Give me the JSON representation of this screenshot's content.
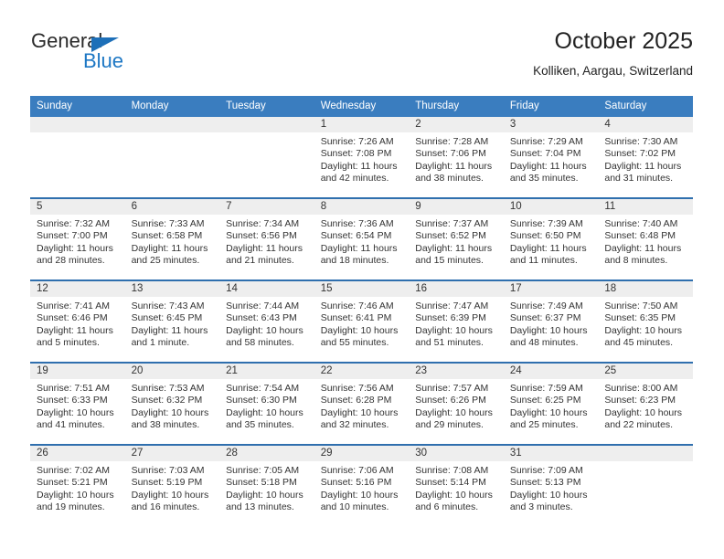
{
  "brand": {
    "line1": "General",
    "line2": "Blue",
    "triangle_color": "#1d6fb8",
    "line2_color": "#1d77c4"
  },
  "header": {
    "title": "October 2025",
    "subtitle": "Kolliken, Aargau, Switzerland"
  },
  "theme": {
    "header_blue": "#3a7dbf",
    "row_border_blue": "#2f6fae",
    "daynum_gray": "#eeeeee"
  },
  "labels": {
    "sunrise": "Sunrise:",
    "sunset": "Sunset:",
    "daylight": "Daylight:"
  },
  "weekdays": [
    "Sunday",
    "Monday",
    "Tuesday",
    "Wednesday",
    "Thursday",
    "Friday",
    "Saturday"
  ],
  "weeks": [
    [
      {
        "day": "",
        "blank": true
      },
      {
        "day": "",
        "blank": true
      },
      {
        "day": "",
        "blank": true
      },
      {
        "day": "1",
        "sunrise": "Sunrise: 7:26 AM",
        "sunset": "Sunset: 7:08 PM",
        "daylight": "Daylight: 11 hours and 42 minutes."
      },
      {
        "day": "2",
        "sunrise": "Sunrise: 7:28 AM",
        "sunset": "Sunset: 7:06 PM",
        "daylight": "Daylight: 11 hours and 38 minutes."
      },
      {
        "day": "3",
        "sunrise": "Sunrise: 7:29 AM",
        "sunset": "Sunset: 7:04 PM",
        "daylight": "Daylight: 11 hours and 35 minutes."
      },
      {
        "day": "4",
        "sunrise": "Sunrise: 7:30 AM",
        "sunset": "Sunset: 7:02 PM",
        "daylight": "Daylight: 11 hours and 31 minutes."
      }
    ],
    [
      {
        "day": "5",
        "sunrise": "Sunrise: 7:32 AM",
        "sunset": "Sunset: 7:00 PM",
        "daylight": "Daylight: 11 hours and 28 minutes."
      },
      {
        "day": "6",
        "sunrise": "Sunrise: 7:33 AM",
        "sunset": "Sunset: 6:58 PM",
        "daylight": "Daylight: 11 hours and 25 minutes."
      },
      {
        "day": "7",
        "sunrise": "Sunrise: 7:34 AM",
        "sunset": "Sunset: 6:56 PM",
        "daylight": "Daylight: 11 hours and 21 minutes."
      },
      {
        "day": "8",
        "sunrise": "Sunrise: 7:36 AM",
        "sunset": "Sunset: 6:54 PM",
        "daylight": "Daylight: 11 hours and 18 minutes."
      },
      {
        "day": "9",
        "sunrise": "Sunrise: 7:37 AM",
        "sunset": "Sunset: 6:52 PM",
        "daylight": "Daylight: 11 hours and 15 minutes."
      },
      {
        "day": "10",
        "sunrise": "Sunrise: 7:39 AM",
        "sunset": "Sunset: 6:50 PM",
        "daylight": "Daylight: 11 hours and 11 minutes."
      },
      {
        "day": "11",
        "sunrise": "Sunrise: 7:40 AM",
        "sunset": "Sunset: 6:48 PM",
        "daylight": "Daylight: 11 hours and 8 minutes."
      }
    ],
    [
      {
        "day": "12",
        "sunrise": "Sunrise: 7:41 AM",
        "sunset": "Sunset: 6:46 PM",
        "daylight": "Daylight: 11 hours and 5 minutes."
      },
      {
        "day": "13",
        "sunrise": "Sunrise: 7:43 AM",
        "sunset": "Sunset: 6:45 PM",
        "daylight": "Daylight: 11 hours and 1 minute."
      },
      {
        "day": "14",
        "sunrise": "Sunrise: 7:44 AM",
        "sunset": "Sunset: 6:43 PM",
        "daylight": "Daylight: 10 hours and 58 minutes."
      },
      {
        "day": "15",
        "sunrise": "Sunrise: 7:46 AM",
        "sunset": "Sunset: 6:41 PM",
        "daylight": "Daylight: 10 hours and 55 minutes."
      },
      {
        "day": "16",
        "sunrise": "Sunrise: 7:47 AM",
        "sunset": "Sunset: 6:39 PM",
        "daylight": "Daylight: 10 hours and 51 minutes."
      },
      {
        "day": "17",
        "sunrise": "Sunrise: 7:49 AM",
        "sunset": "Sunset: 6:37 PM",
        "daylight": "Daylight: 10 hours and 48 minutes."
      },
      {
        "day": "18",
        "sunrise": "Sunrise: 7:50 AM",
        "sunset": "Sunset: 6:35 PM",
        "daylight": "Daylight: 10 hours and 45 minutes."
      }
    ],
    [
      {
        "day": "19",
        "sunrise": "Sunrise: 7:51 AM",
        "sunset": "Sunset: 6:33 PM",
        "daylight": "Daylight: 10 hours and 41 minutes."
      },
      {
        "day": "20",
        "sunrise": "Sunrise: 7:53 AM",
        "sunset": "Sunset: 6:32 PM",
        "daylight": "Daylight: 10 hours and 38 minutes."
      },
      {
        "day": "21",
        "sunrise": "Sunrise: 7:54 AM",
        "sunset": "Sunset: 6:30 PM",
        "daylight": "Daylight: 10 hours and 35 minutes."
      },
      {
        "day": "22",
        "sunrise": "Sunrise: 7:56 AM",
        "sunset": "Sunset: 6:28 PM",
        "daylight": "Daylight: 10 hours and 32 minutes."
      },
      {
        "day": "23",
        "sunrise": "Sunrise: 7:57 AM",
        "sunset": "Sunset: 6:26 PM",
        "daylight": "Daylight: 10 hours and 29 minutes."
      },
      {
        "day": "24",
        "sunrise": "Sunrise: 7:59 AM",
        "sunset": "Sunset: 6:25 PM",
        "daylight": "Daylight: 10 hours and 25 minutes."
      },
      {
        "day": "25",
        "sunrise": "Sunrise: 8:00 AM",
        "sunset": "Sunset: 6:23 PM",
        "daylight": "Daylight: 10 hours and 22 minutes."
      }
    ],
    [
      {
        "day": "26",
        "sunrise": "Sunrise: 7:02 AM",
        "sunset": "Sunset: 5:21 PM",
        "daylight": "Daylight: 10 hours and 19 minutes."
      },
      {
        "day": "27",
        "sunrise": "Sunrise: 7:03 AM",
        "sunset": "Sunset: 5:19 PM",
        "daylight": "Daylight: 10 hours and 16 minutes."
      },
      {
        "day": "28",
        "sunrise": "Sunrise: 7:05 AM",
        "sunset": "Sunset: 5:18 PM",
        "daylight": "Daylight: 10 hours and 13 minutes."
      },
      {
        "day": "29",
        "sunrise": "Sunrise: 7:06 AM",
        "sunset": "Sunset: 5:16 PM",
        "daylight": "Daylight: 10 hours and 10 minutes."
      },
      {
        "day": "30",
        "sunrise": "Sunrise: 7:08 AM",
        "sunset": "Sunset: 5:14 PM",
        "daylight": "Daylight: 10 hours and 6 minutes."
      },
      {
        "day": "31",
        "sunrise": "Sunrise: 7:09 AM",
        "sunset": "Sunset: 5:13 PM",
        "daylight": "Daylight: 10 hours and 3 minutes."
      },
      {
        "day": "",
        "blank": true
      }
    ]
  ]
}
